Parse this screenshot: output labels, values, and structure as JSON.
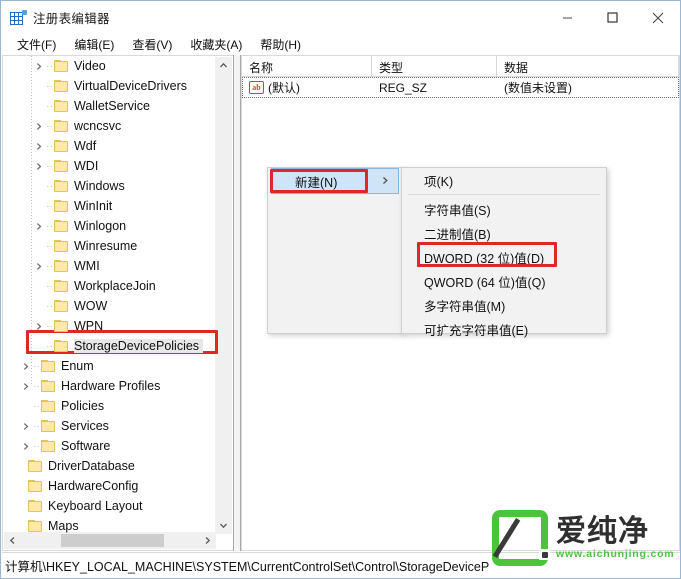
{
  "window": {
    "title": "注册表编辑器",
    "icon": "registry-editor-icon",
    "controls": {
      "minimize": "minimize-icon",
      "maximize": "maximize-icon",
      "close": "close-icon"
    }
  },
  "menubar": {
    "items": [
      {
        "label": "文件(F)"
      },
      {
        "label": "编辑(E)"
      },
      {
        "label": "查看(V)"
      },
      {
        "label": "收藏夹(A)"
      },
      {
        "label": "帮助(H)"
      }
    ]
  },
  "tree": {
    "items": [
      {
        "label": "Video",
        "indent": 2,
        "expandable": true,
        "selected": false
      },
      {
        "label": "VirtualDeviceDrivers",
        "indent": 2,
        "expandable": false,
        "selected": false
      },
      {
        "label": "WalletService",
        "indent": 2,
        "expandable": false,
        "selected": false
      },
      {
        "label": "wcncsvc",
        "indent": 2,
        "expandable": true,
        "selected": false
      },
      {
        "label": "Wdf",
        "indent": 2,
        "expandable": true,
        "selected": false
      },
      {
        "label": "WDI",
        "indent": 2,
        "expandable": true,
        "selected": false
      },
      {
        "label": "Windows",
        "indent": 2,
        "expandable": false,
        "selected": false
      },
      {
        "label": "WinInit",
        "indent": 2,
        "expandable": false,
        "selected": false
      },
      {
        "label": "Winlogon",
        "indent": 2,
        "expandable": true,
        "selected": false
      },
      {
        "label": "Winresume",
        "indent": 2,
        "expandable": false,
        "selected": false
      },
      {
        "label": "WMI",
        "indent": 2,
        "expandable": true,
        "selected": false
      },
      {
        "label": "WorkplaceJoin",
        "indent": 2,
        "expandable": false,
        "selected": false
      },
      {
        "label": "WOW",
        "indent": 2,
        "expandable": false,
        "selected": false
      },
      {
        "label": "WPN",
        "indent": 2,
        "expandable": true,
        "selected": false
      },
      {
        "label": "StorageDevicePolicies",
        "indent": 2,
        "expandable": false,
        "selected": true
      },
      {
        "label": "Enum",
        "indent": 1,
        "expandable": true,
        "selected": false
      },
      {
        "label": "Hardware Profiles",
        "indent": 1,
        "expandable": true,
        "selected": false
      },
      {
        "label": "Policies",
        "indent": 1,
        "expandable": false,
        "selected": false
      },
      {
        "label": "Services",
        "indent": 1,
        "expandable": true,
        "selected": false
      },
      {
        "label": "Software",
        "indent": 1,
        "expandable": true,
        "selected": false
      },
      {
        "label": "DriverDatabase",
        "indent": 0,
        "expandable": false,
        "selected": false
      },
      {
        "label": "HardwareConfig",
        "indent": 0,
        "expandable": false,
        "selected": false
      },
      {
        "label": "Keyboard Layout",
        "indent": 0,
        "expandable": false,
        "selected": false
      },
      {
        "label": "Maps",
        "indent": 0,
        "expandable": false,
        "selected": false
      }
    ],
    "scroll": {
      "up_arrow": "chevron-up-icon",
      "down_arrow": "chevron-down-icon",
      "left_arrow": "chevron-left-icon",
      "right_arrow": "chevron-right-icon"
    }
  },
  "list": {
    "columns": [
      {
        "label": "名称",
        "width": 130
      },
      {
        "label": "类型",
        "width": 125
      },
      {
        "label": "数据",
        "width": 184
      }
    ],
    "rows": [
      {
        "icon": "string-value-icon",
        "name": "(默认)",
        "type": "REG_SZ",
        "data": "(数值未设置)"
      }
    ]
  },
  "context_menu": {
    "parent": {
      "items": [
        {
          "label": "新建(N)",
          "hover": true,
          "has_submenu": true,
          "submenu_arrow": "chevron-right-icon"
        }
      ]
    },
    "submenu": {
      "items": [
        {
          "label": "项(K)"
        },
        {
          "label": "字符串值(S)"
        },
        {
          "label": "二进制值(B)"
        },
        {
          "label": "DWORD (32 位)值(D)"
        },
        {
          "label": "QWORD (64 位)值(Q)"
        },
        {
          "label": "多字符串值(M)"
        },
        {
          "label": "可扩充字符串值(E)"
        }
      ]
    }
  },
  "annotations": {
    "accent_color": "#e02727",
    "boxes": [
      {
        "target": "StorageDevicePolicies"
      },
      {
        "target": "新建(N)"
      },
      {
        "target": "DWORD (32 位)值(D)"
      }
    ]
  },
  "statusbar": {
    "path": "计算机\\HKEY_LOCAL_MACHINE\\SYSTEM\\CurrentControlSet\\Control\\StorageDeviceP"
  },
  "watermark": {
    "brand": "爱纯净",
    "url": "www.aichunjing.com",
    "logo_color": "#4cc23f"
  }
}
